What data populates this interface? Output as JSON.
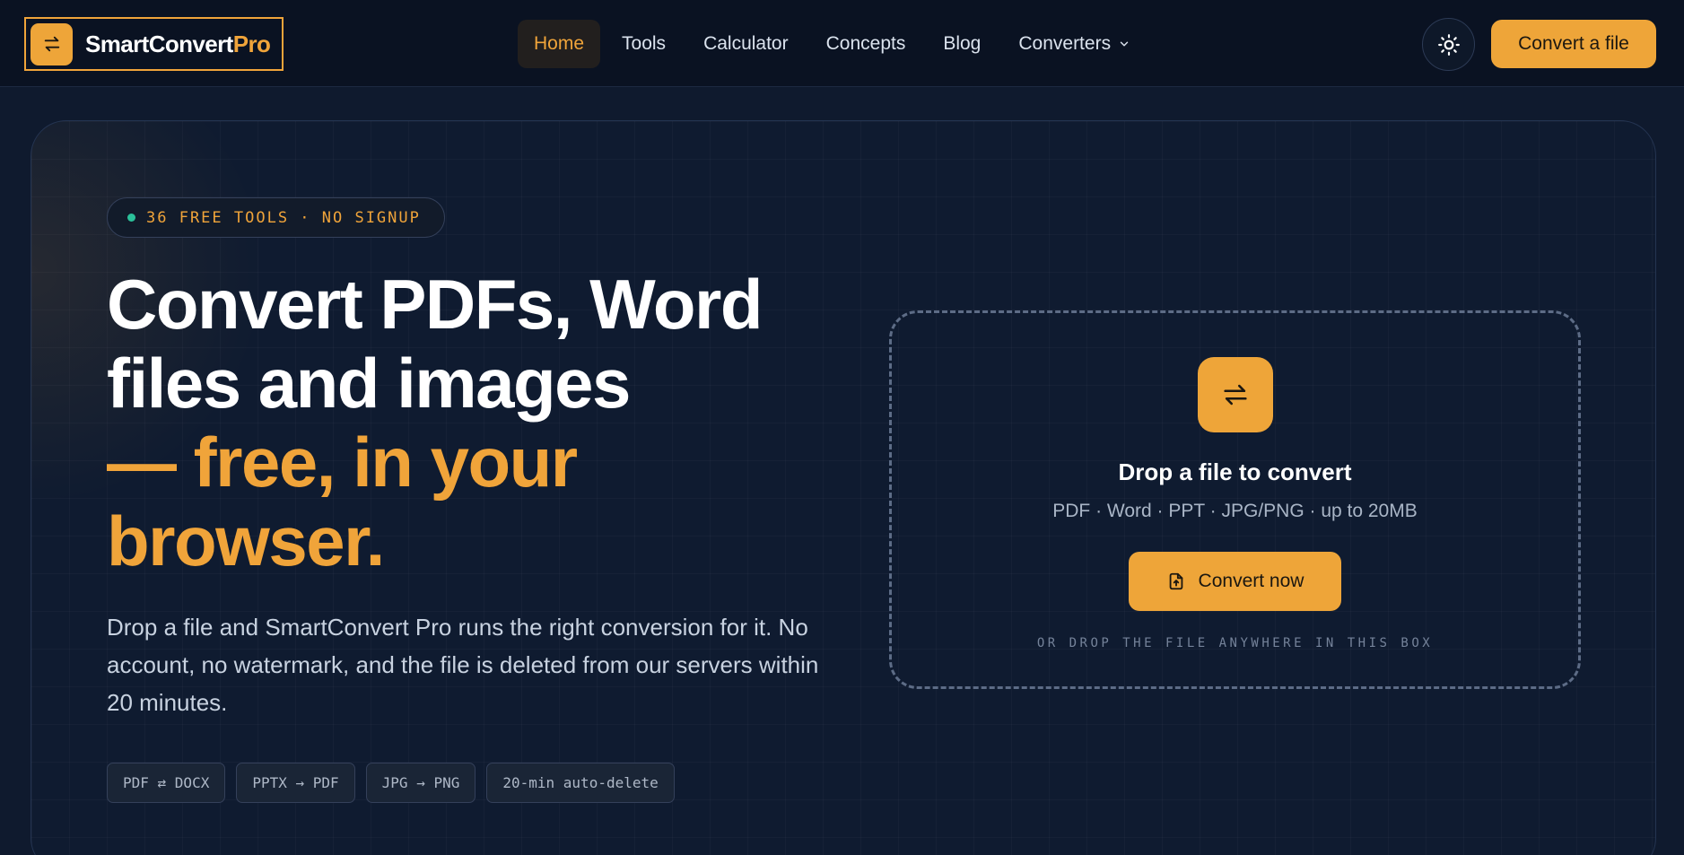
{
  "logo": {
    "name": "SmartConvert",
    "accent": "Pro",
    "icon": "swap-arrows-icon"
  },
  "nav": {
    "items": [
      {
        "label": "Home",
        "active": true
      },
      {
        "label": "Tools"
      },
      {
        "label": "Calculator"
      },
      {
        "label": "Concepts"
      },
      {
        "label": "Blog"
      },
      {
        "label": "Converters",
        "icon": "chevron-down-icon"
      }
    ]
  },
  "header": {
    "theme_icon": "sun-icon",
    "cta_label": "Convert a file"
  },
  "hero": {
    "badge": "36 FREE TOOLS · NO SIGNUP",
    "headline": {
      "line1": "Convert PDFs, Word",
      "line2": "files and images",
      "line3": "— free, in your browser."
    },
    "lede": "Drop a file and SmartConvert Pro runs the right conversion for it. No account, no watermark, and the file is deleted from our servers within 20 minutes.",
    "chips": [
      "PDF ⇄ DOCX",
      "PPTX → PDF",
      "JPG → PNG",
      "20-min auto-delete"
    ]
  },
  "dropzone": {
    "icon": "swap-arrows-icon",
    "title": "Drop a file to convert",
    "subtitle": "PDF · Word · PPT · JPG/PNG · up to 20MB",
    "button_label": "Convert now",
    "button_icon": "file-upload-icon",
    "hint": "OR DROP THE FILE ANYWHERE IN THIS BOX"
  },
  "colors": {
    "accent": "#eea539",
    "background": "#0f1a2e",
    "status_dot": "#2bc19a"
  }
}
